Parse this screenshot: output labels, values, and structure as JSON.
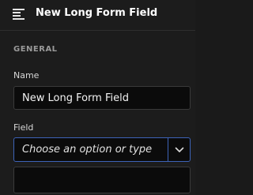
{
  "header": {
    "title": "New Long Form Field",
    "menu_icon": "hamburger-menu-icon"
  },
  "section": {
    "title": "GENERAL"
  },
  "name_field": {
    "label": "Name",
    "value": "New Long Form Field"
  },
  "type_field": {
    "label": "Field",
    "placeholder": "Choose an option or type",
    "value": "",
    "dropdown_icon": "chevron-down-icon"
  },
  "colors": {
    "background": "#1c1c1c",
    "input_background": "#0b0b0b",
    "focus_border": "#3d63b8"
  }
}
